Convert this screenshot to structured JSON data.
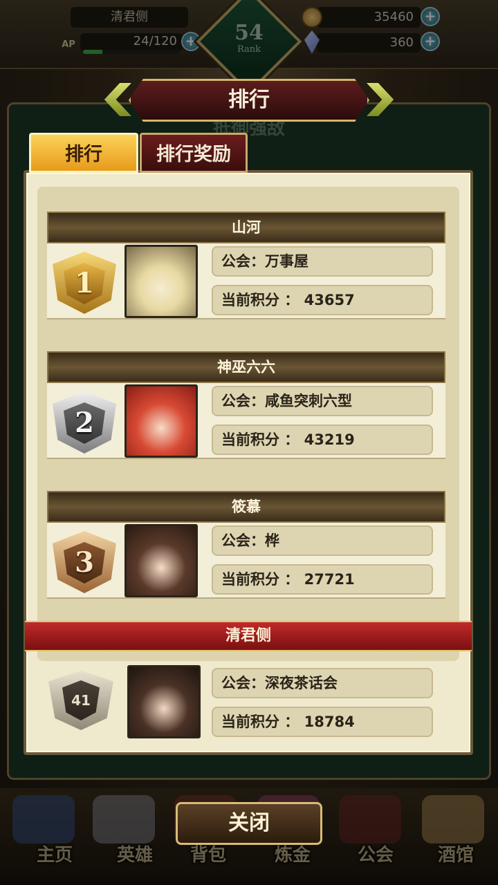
{
  "hud": {
    "player_name": "清君侧",
    "ap_label": "AP",
    "ap_value": "24/120",
    "ap_fill": 0.2,
    "rank_number": "54",
    "rank_label": "Rank",
    "coins": "35460",
    "gems": "360",
    "plus": "+"
  },
  "background": {
    "board_title": "抵御强敌"
  },
  "modal": {
    "title": "排行",
    "tabs": [
      {
        "label": "排行",
        "active": true
      },
      {
        "label": "排行奖励",
        "active": false
      }
    ],
    "entries": [
      {
        "rank": "1",
        "name": "山河",
        "guild": "公会：万事屋",
        "score": "当前积分 ： 43657"
      },
      {
        "rank": "2",
        "name": "神巫六六",
        "guild": "公会：咸鱼突刺六型",
        "score": "当前积分 ： 43219"
      },
      {
        "rank": "3",
        "name": "筱慕",
        "guild": "公会：桦",
        "score": "当前积分 ： 27721"
      }
    ],
    "self": {
      "name": "清君侧",
      "rank": "41",
      "guild": "公会：深夜茶话会",
      "score": "当前积分 ： 18784"
    },
    "close_label": "关闭"
  },
  "nav": [
    {
      "label": "主页"
    },
    {
      "label": "英雄"
    },
    {
      "label": "背包"
    },
    {
      "label": "炼金"
    },
    {
      "label": "公会"
    },
    {
      "label": "酒馆"
    }
  ],
  "colors": {
    "accent_gold": "#e79a1a",
    "title_red": "#5c1c1c",
    "banner_red": "#c02a2a",
    "panel_bg": "#efe9cd"
  }
}
